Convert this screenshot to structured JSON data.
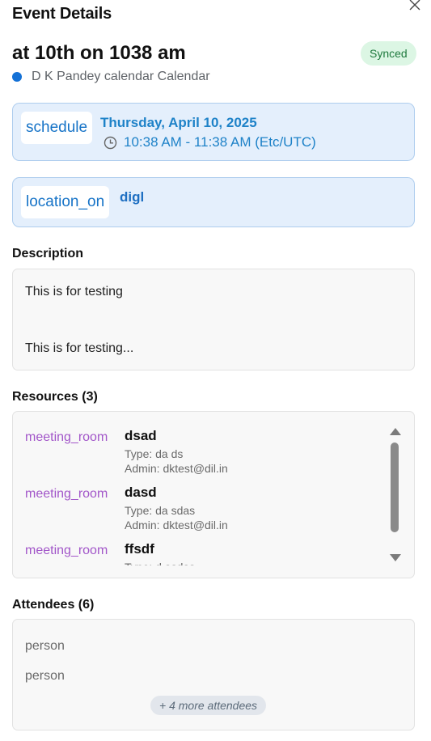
{
  "header": {
    "title": "Event Details",
    "close_icon": "close-icon"
  },
  "event": {
    "name": "at 10th on 1038 am",
    "status_badge": "Synced",
    "calendar_name": "D K Pandey calendar Calendar",
    "calendar_color": "#1471d6"
  },
  "schedule": {
    "icon_label": "schedule",
    "date": "Thursday, April 10, 2025",
    "time": "10:38 AM - 11:38 AM (Etc/UTC)",
    "time_icon": "clock-icon"
  },
  "location": {
    "icon_label": "location_on",
    "value": "digl"
  },
  "description": {
    "heading": "Description",
    "line1": "This is for testing",
    "line2": "This is for testing..."
  },
  "resources": {
    "heading": "Resources (3)",
    "items": [
      {
        "icon_label": "meeting_room",
        "name": "dsad",
        "type": "Type: da ds",
        "admin": "Admin: dktest@dil.in"
      },
      {
        "icon_label": "meeting_room",
        "name": "dasd",
        "type": "Type: da sdas",
        "admin": "Admin: dktest@dil.in"
      },
      {
        "icon_label": "meeting_room",
        "name": "ffsdf",
        "type": "Type: d asdas",
        "admin": ""
      }
    ]
  },
  "attendees": {
    "heading": "Attendees (6)",
    "items": [
      {
        "label": "person"
      },
      {
        "label": "person"
      }
    ],
    "more_label": "+ 4 more attendees"
  },
  "colors": {
    "accent_blue": "#1e82c8",
    "card_bg": "#e4effc",
    "resource_icon": "#a256c9",
    "synced_bg": "#dcf6e4",
    "synced_text": "#1f7a3e"
  }
}
